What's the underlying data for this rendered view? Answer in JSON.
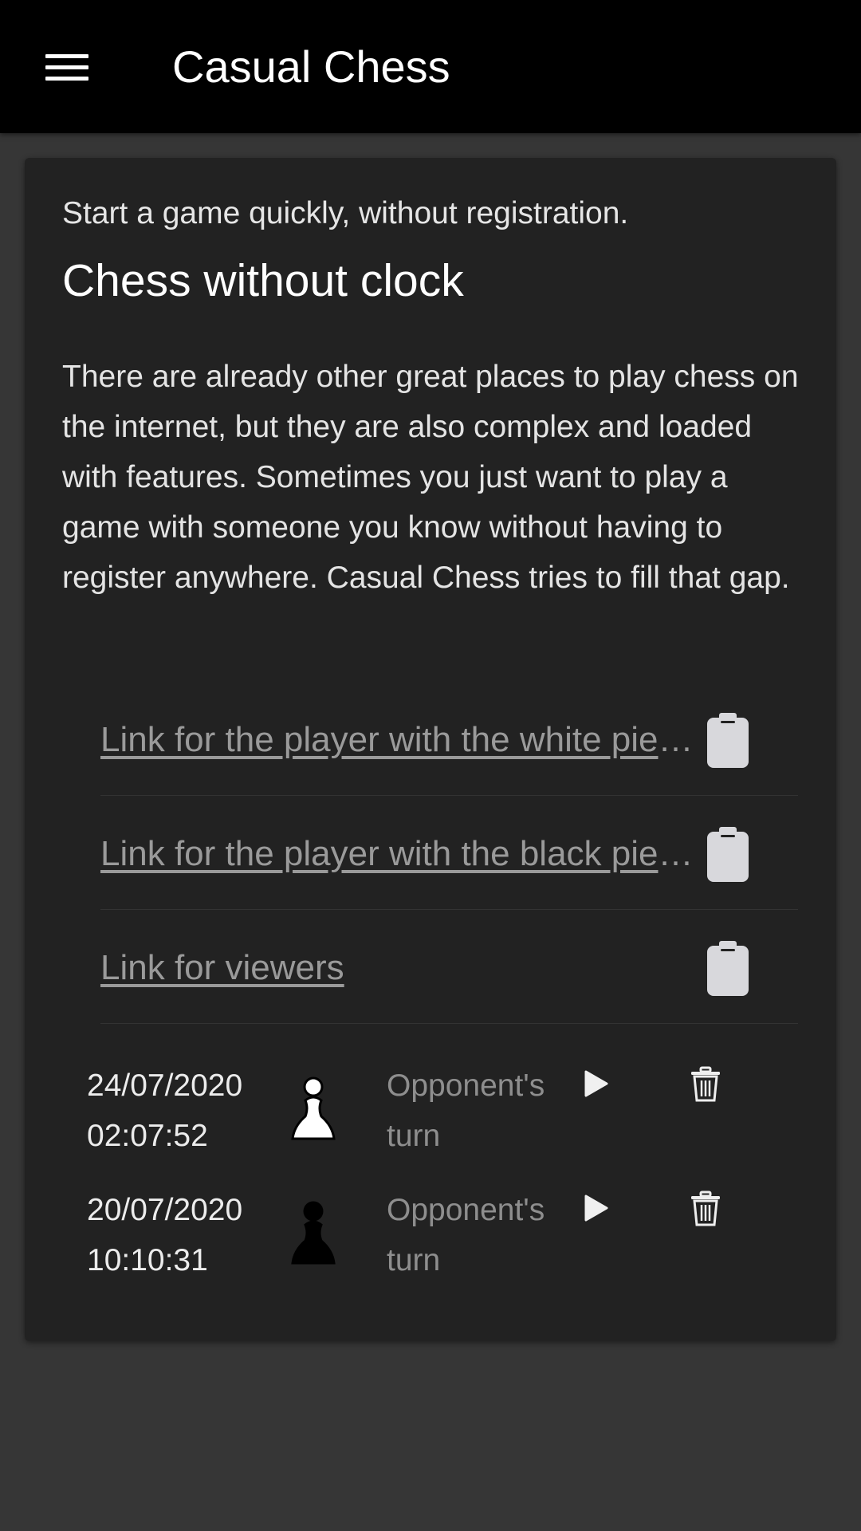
{
  "appbar": {
    "title": "Casual Chess",
    "menu_icon": "menu-icon"
  },
  "card": {
    "intro": "Start a game quickly, without registration.",
    "heading": "Chess without clock",
    "description": "There are already other great places to play chess on the internet, but they are also complex and loaded with features. Sometimes you just want to play a game with someone you know without having to register anywhere. Casual Chess tries to fill that gap.",
    "links": [
      {
        "label": "Link for the player with the white pieces",
        "icon": "clipboard-icon"
      },
      {
        "label": "Link for the player with the black pieces",
        "icon": "clipboard-icon"
      },
      {
        "label": "Link for viewers",
        "icon": "clipboard-icon"
      }
    ],
    "games": [
      {
        "date": "24/07/2020",
        "time": "02:07:52",
        "piece": "white-pawn",
        "status": "Opponent's",
        "status2": "turn"
      },
      {
        "date": "20/07/2020",
        "time": "10:10:31",
        "piece": "black-pawn",
        "status": "Opponent's",
        "status2": "turn"
      }
    ]
  },
  "colors": {
    "appbar_bg": "#000000",
    "page_bg": "#363636",
    "card_bg": "#222222",
    "link": "#9a9a9a",
    "status": "#8e8e8e",
    "clipboard": "#d8d8dc"
  }
}
